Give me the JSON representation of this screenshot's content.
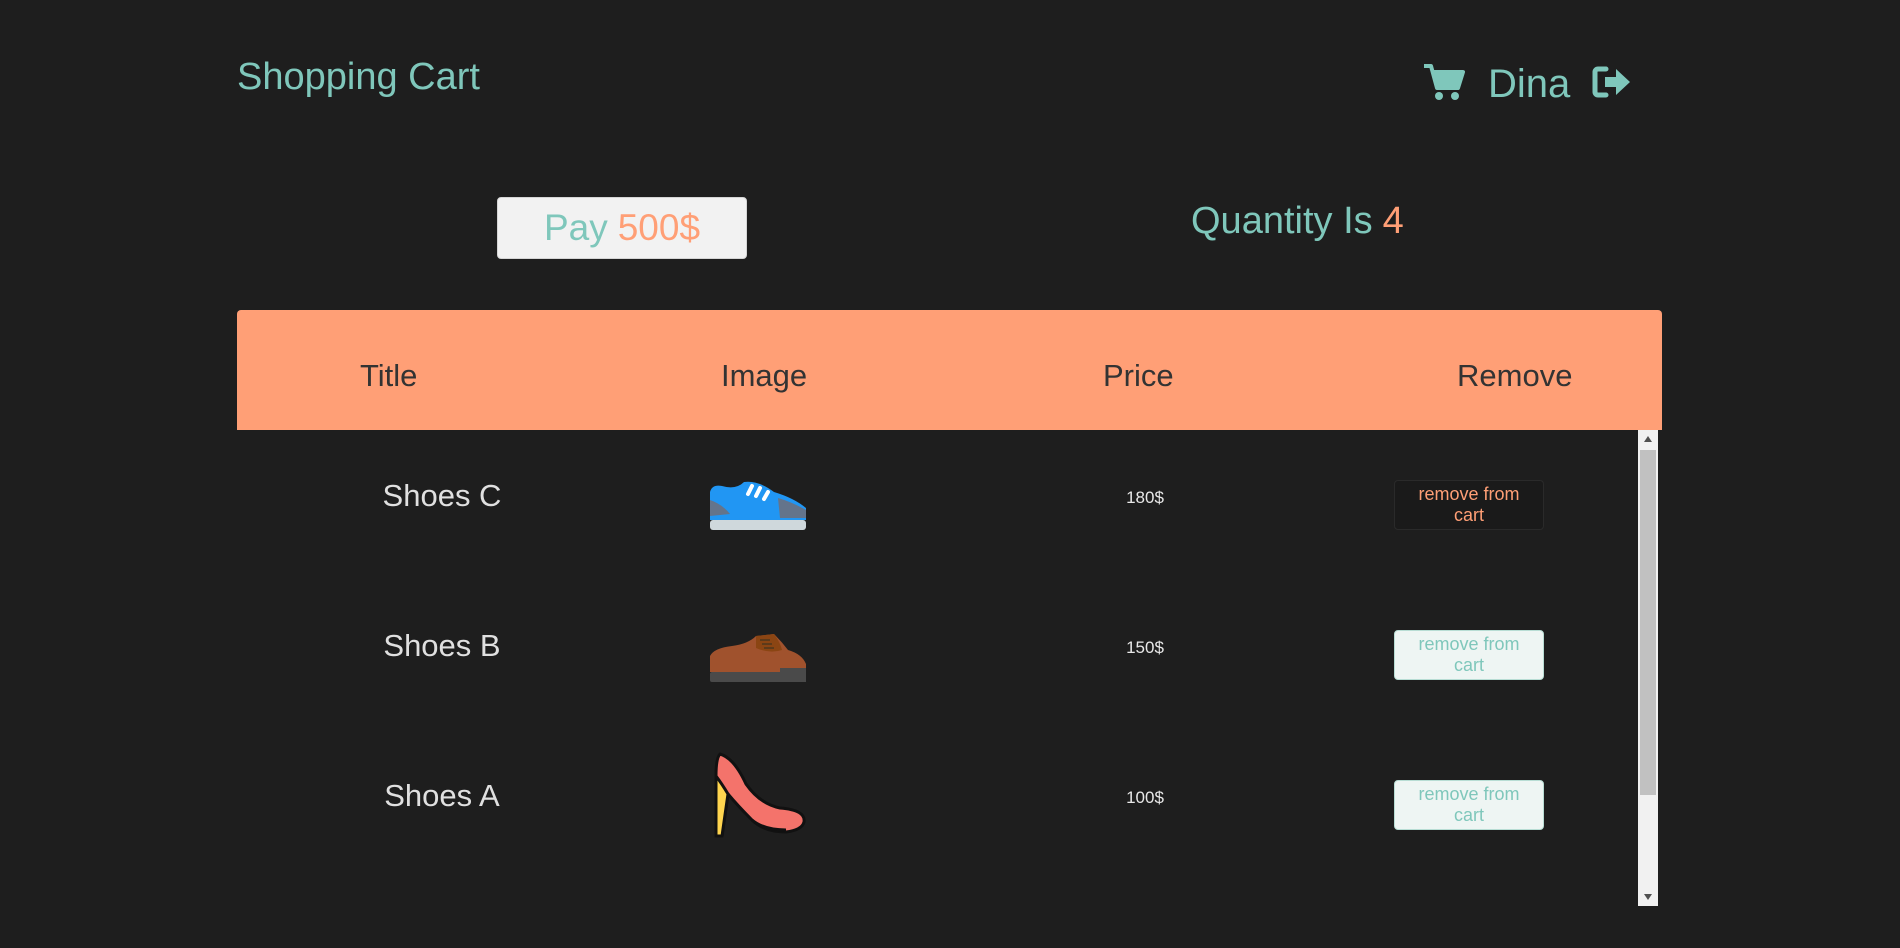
{
  "header": {
    "brand": "Shopping Cart",
    "username": "Dina",
    "cart_icon": "shopping-cart-icon",
    "logout_icon": "sign-out-icon"
  },
  "summary": {
    "pay_label": "Pay",
    "pay_amount": "500$",
    "quantity_label": "Quantity Is",
    "quantity_value": "4"
  },
  "table": {
    "columns": [
      "Title",
      "Image",
      "Price",
      "Remove"
    ],
    "rows": [
      {
        "title": "Shoes C",
        "image": "sneaker-image",
        "price": "180$",
        "action": "remove from cart"
      },
      {
        "title": "Shoes B",
        "image": "leather-shoe-image",
        "price": "150$",
        "action": "remove from cart"
      },
      {
        "title": "Shoes A",
        "image": "high-heel-image",
        "price": "100$",
        "action": "remove from cart"
      }
    ]
  },
  "colors": {
    "background": "#1e1e1e",
    "teal": "#7fc7bb",
    "accent": "#ff9f76"
  }
}
